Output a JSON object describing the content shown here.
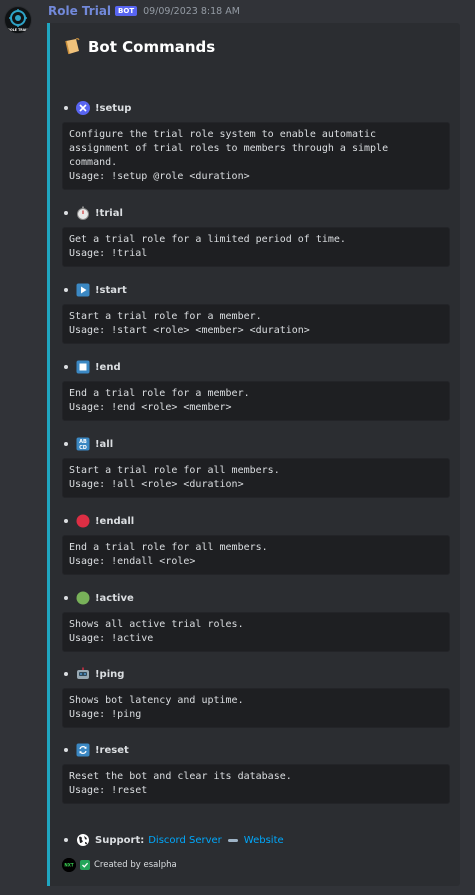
{
  "message": {
    "username": "Role Trial",
    "bot_tag": "BOT",
    "timestamp": "09/09/2023 8:18 AM",
    "avatar_text": "ROLE TRIAL"
  },
  "embed": {
    "accent_color": "#1fa6c1",
    "title_icon": "scroll-icon",
    "title": "Bot Commands",
    "commands": [
      {
        "icon": "tools-icon",
        "name": "!setup",
        "code": "Configure the trial role system to enable automatic\nassignment of trial roles to members through a simple\ncommand.\nUsage: !setup @role <duration>"
      },
      {
        "icon": "stopwatch-icon",
        "name": "!trial",
        "code": "Get a trial role for a limited period of time.\nUsage: !trial"
      },
      {
        "icon": "play-button-icon",
        "name": "!start",
        "code": "Start a trial role for a member.\nUsage: !start <role> <member> <duration>"
      },
      {
        "icon": "stop-button-icon",
        "name": "!end",
        "code": "End a trial role for a member.\nUsage: !end <role> <member>"
      },
      {
        "icon": "abcd-icon",
        "name": "!all",
        "code": "Start a trial role for all members.\nUsage: !all <role> <duration>"
      },
      {
        "icon": "red-circle-icon",
        "name": "!endall",
        "code": "End a trial role for all members.\nUsage: !endall <role>"
      },
      {
        "icon": "green-circle-icon",
        "name": "!active",
        "code": "Shows all active trial roles.\nUsage: !active"
      },
      {
        "icon": "robot-icon",
        "name": "!ping",
        "code": "Shows bot latency and uptime.\nUsage: !ping"
      },
      {
        "icon": "arrows-cycle-icon",
        "name": "!reset",
        "code": "Reset the bot and clear its database.\nUsage: !reset"
      }
    ],
    "footer": {
      "support_label": "Support:",
      "link1": "Discord Server",
      "link2": "Website",
      "credit_avatar_text": "NXT",
      "credit": "Created by esalpha"
    }
  }
}
